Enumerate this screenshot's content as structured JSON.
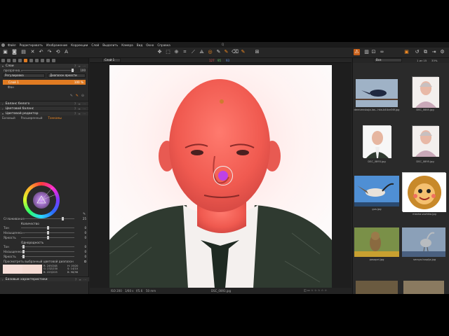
{
  "window": {
    "title": "Q"
  },
  "menu": [
    "Файл",
    "Редактировать",
    "Изображение",
    "Коррекции",
    "Слой",
    "Выделить",
    "Камера",
    "Вид",
    "Окно",
    "Справка"
  ],
  "left_panel": {
    "layers_header": "Слои",
    "layer_hint": "прозрачно…",
    "layer_hint_value": "100",
    "layer_dd1": "Регулировка",
    "layer_dd2": "Диапазон яркости",
    "layer_name": "Слой 1",
    "layer_pct": "100 %",
    "bg_label": "Фон",
    "sections": [
      "Баланс белого",
      "Цветовой баланс",
      "Цветовой редактор"
    ],
    "subtabs": [
      "Базовый",
      "Расширенный",
      "Тонкомы"
    ],
    "smoothing_label": "Сглаживание",
    "smoothing_value": "25",
    "saturation_title": "Количество",
    "tone_label": "Тон",
    "saturation_label": "Насыщенно…",
    "brightness_label": "Яркость",
    "uniformity_title": "Однородность",
    "zero": "0",
    "preview_label": "Просмотреть выбранный цветовой диапазон",
    "rgb_r": "R:",
    "rgb_g": "G:",
    "rgb_b": "B:",
    "rgb_vals1": "249/248",
    "rgb_vals2": "232/230",
    "rgb_vals3": "223/225",
    "hsb_h": "H:",
    "hsb_s": "S:",
    "hsb_b": "B:",
    "hsb_vals1": "19/20",
    "hsb_vals2": "14/10",
    "hsb_vals3": "98/98",
    "base_section": "Базовые характеристики"
  },
  "center": {
    "preset_select": "Слой 1",
    "rgb_readout_r": "127",
    "rgb_readout_g": "95",
    "rgb_readout_b": "93",
    "footer_iso": "ISO 200",
    "footer_shutter": "1/60 s",
    "footer_aperture": "f/5.6",
    "footer_focal": "50 mm",
    "footer_file": "DSC_0893.jpg"
  },
  "right_panel": {
    "filter": "Все",
    "counter": "1 из 15",
    "zoom": "33%",
    "thumbs": [
      {
        "name": "derevenskaja-las...hka-b44ce36f.jpg",
        "kind": "swallow"
      },
      {
        "name": "DSC_0885.jpg",
        "kind": "woman"
      },
      {
        "name": "DSC_0893.jpg",
        "kind": "man"
      },
      {
        "name": "DSC_0895.jpg",
        "kind": "woman2"
      },
      {
        "name": "gus.jpg",
        "kind": "goose"
      },
      {
        "name": "masha-vozhika.jpg",
        "kind": "cartoon"
      },
      {
        "name": "pasopel.jpg",
        "kind": "owl"
      },
      {
        "name": "seraya-tsaplja.jpg",
        "kind": "heron"
      }
    ]
  },
  "colors": {
    "accent": "#e07b22",
    "panel": "#2a2a2a",
    "skin": "#f5625a"
  }
}
